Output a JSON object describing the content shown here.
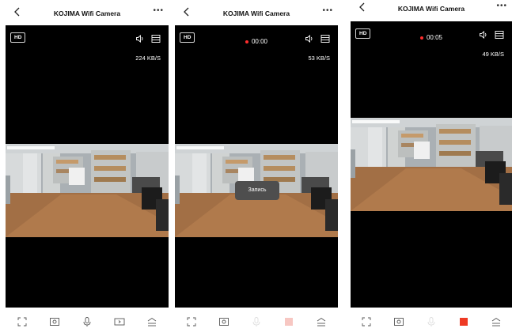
{
  "screens": [
    {
      "title": "KOJIMA Wifi Camera",
      "quality_badge": "HD",
      "speed": "224 KB/S",
      "controls": {
        "mic_state": "enabled",
        "record_state": "idle"
      }
    },
    {
      "title": "KOJIMA Wifi Camera",
      "quality_badge": "HD",
      "recording_time": "00:00",
      "speed": "53 KB/S",
      "toast": "Запись",
      "controls": {
        "mic_state": "disabled",
        "record_state": "starting"
      }
    },
    {
      "title": "KOJIMA Wifi Camera",
      "quality_badge": "HD",
      "recording_time": "00:05",
      "speed": "49 KB/S",
      "controls": {
        "mic_state": "disabled",
        "record_state": "recording"
      }
    }
  ],
  "camera_overlay": {
    "timestamp": "2023-11-28 10:37:34"
  },
  "colors": {
    "recording_dot": "#ff2d2d",
    "record_active": "#ee3a24",
    "record_pending": "#f7c7c2",
    "mic_disabled": "#dddddd"
  }
}
